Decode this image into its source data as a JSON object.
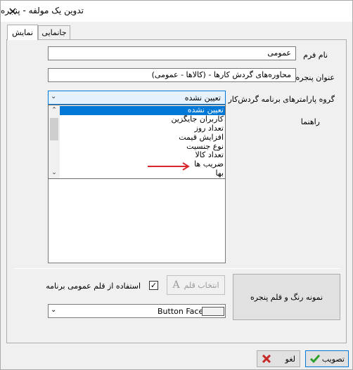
{
  "window": {
    "title": "تدوین یک مولفه - پنجره",
    "close_glyph": "✕"
  },
  "tabs": [
    {
      "label": "نمایش"
    },
    {
      "label": "جانمایی"
    }
  ],
  "form": {
    "form_name_label": "نام فرم",
    "form_name_value": "عمومی",
    "window_title_label": "عنوان پنجره",
    "window_title_value": "محاوره‌های گردش کارها - (کالاها - عمومی)",
    "workflow_group_label": "گروه پارامترهای برنامه گردش‌کار",
    "workflow_group_value": "تعیین نشده",
    "guide_label": "راهنما"
  },
  "dropdown_list": {
    "items": [
      "تعیین نشده",
      "کاربران جایگزین",
      "تعداد روز",
      "افزایش قیمت",
      "نوع جنسیت",
      "تعداد کالا",
      "ضریب ها",
      "بها"
    ],
    "selected_index": 0,
    "arrow_color": "#d9262c"
  },
  "font_section": {
    "select_font_label": "انتخاب قلم",
    "select_font_icon": "A",
    "use_default_font_label": "استفاده از قلم عمومی برنامه",
    "use_default_font_checked": true,
    "check_glyph": "✓",
    "color_value": "Button Face",
    "preview_button_label": "نمونه رنگ و قلم پنجره"
  },
  "footer": {
    "approve_label": "تصویب",
    "cancel_label": "لغو",
    "approve_icon": "check-icon",
    "cancel_icon": "cross-icon"
  },
  "colors": {
    "accent": "#0078d7",
    "approve_green": "#2e9e2e",
    "cancel_red": "#c62828"
  }
}
